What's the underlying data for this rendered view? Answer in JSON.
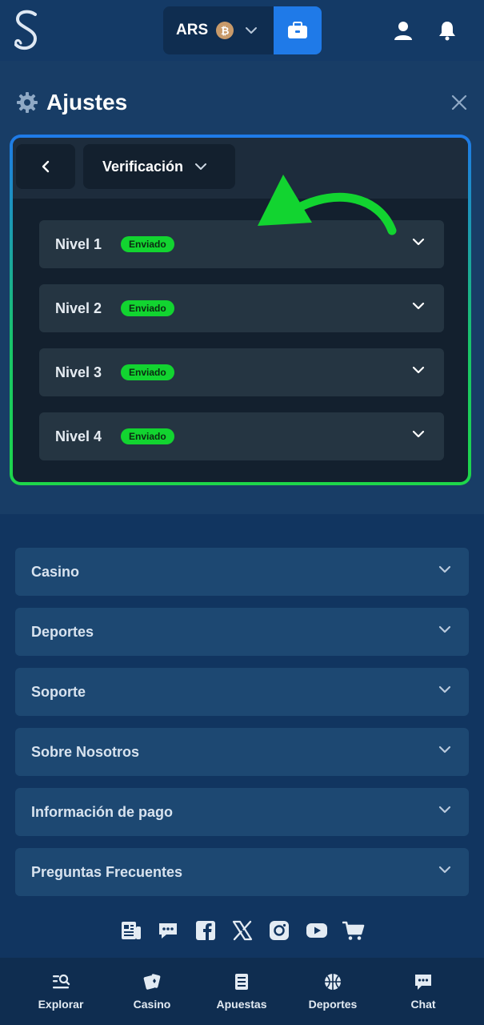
{
  "header": {
    "currency_code": "ARS",
    "coin_symbol": "₿"
  },
  "settings": {
    "title": "Ajustes",
    "section_label": "Verificación",
    "levels": [
      {
        "label": "Nivel 1",
        "status": "Enviado"
      },
      {
        "label": "Nivel 2",
        "status": "Enviado"
      },
      {
        "label": "Nivel 3",
        "status": "Enviado"
      },
      {
        "label": "Nivel 4",
        "status": "Enviado"
      }
    ]
  },
  "footer_menu": [
    {
      "label": "Casino"
    },
    {
      "label": "Deportes"
    },
    {
      "label": "Soporte"
    },
    {
      "label": "Sobre Nosotros"
    },
    {
      "label": "Información de pago"
    },
    {
      "label": "Preguntas Frecuentes"
    }
  ],
  "bottom_nav": [
    {
      "label": "Explorar",
      "icon": "search-list-icon"
    },
    {
      "label": "Casino",
      "icon": "cards-icon"
    },
    {
      "label": "Apuestas",
      "icon": "betslip-icon"
    },
    {
      "label": "Deportes",
      "icon": "basketball-icon"
    },
    {
      "label": "Chat",
      "icon": "chat-icon"
    }
  ],
  "colors": {
    "accent_blue": "#1f7ae8",
    "success_green": "#12d430",
    "page_bg": "#113560"
  }
}
